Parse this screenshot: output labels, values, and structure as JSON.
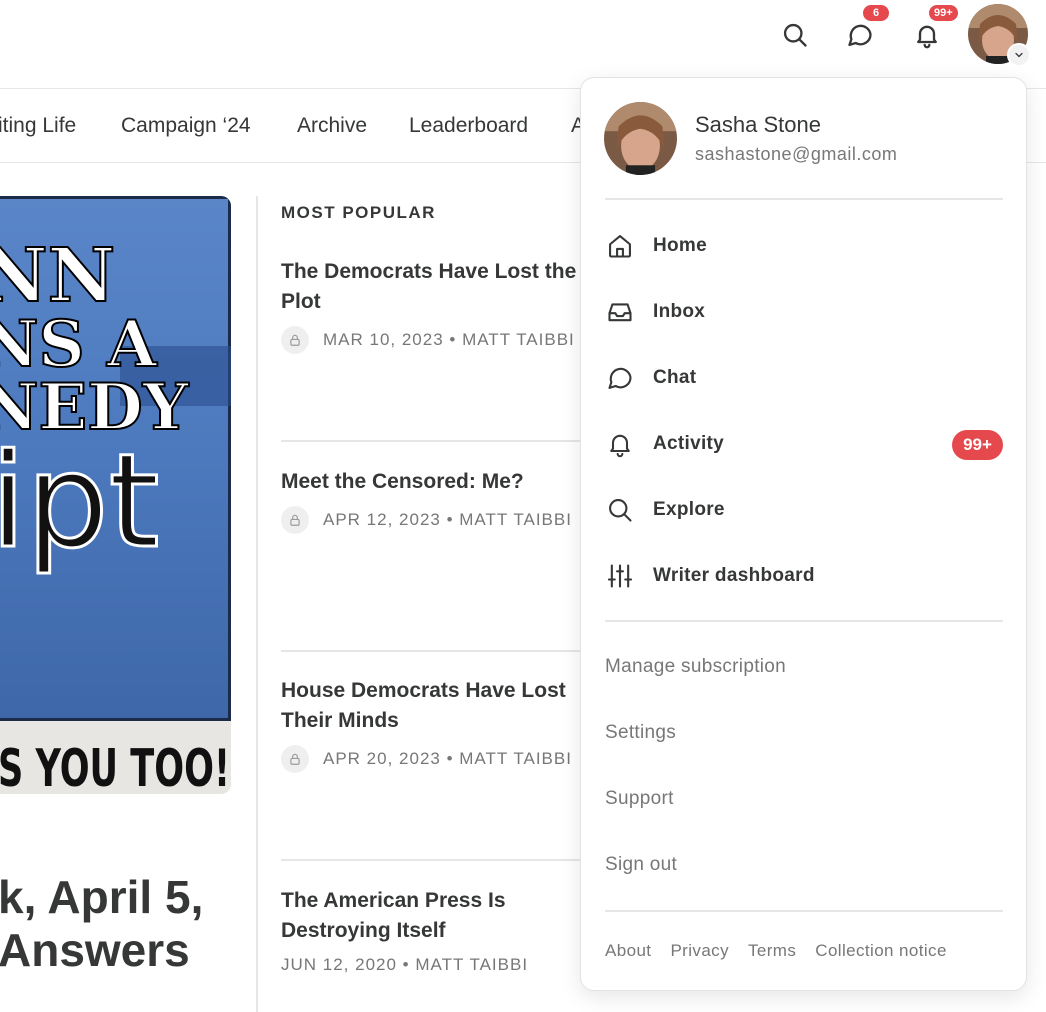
{
  "header": {
    "chat_badge": "6",
    "activity_badge": "99+"
  },
  "nav": {
    "items": [
      "iting Life",
      "Campaign ‘24",
      "Archive",
      "Leaderboard",
      "A"
    ]
  },
  "hero": {
    "image_lines": [
      "NN",
      "NS A",
      "NEDY",
      "ipt",
      "S YOU TOO!"
    ]
  },
  "main_post": {
    "title_line1": "k, April 5,",
    "title_line2": "Answers"
  },
  "most_popular": {
    "heading": "MOST POPULAR",
    "items": [
      {
        "title": "The Democrats Have Lost the Plot",
        "meta": "MAR 10, 2023 • MATT TAIBBI",
        "locked": true
      },
      {
        "title": "Meet the Censored: Me?",
        "meta": "APR 12, 2023 • MATT TAIBBI",
        "locked": true
      },
      {
        "title": "House Democrats Have Lost Their Minds",
        "meta": "APR 20, 2023 • MATT TAIBBI",
        "locked": true
      },
      {
        "title": "The American Press Is Destroying Itself",
        "meta": "JUN 12, 2020 • MATT TAIBBI",
        "locked": false
      }
    ]
  },
  "menu": {
    "user_name": "Sasha Stone",
    "user_email": "sashastone@gmail.com",
    "items": [
      {
        "label": "Home",
        "icon": "home-icon"
      },
      {
        "label": "Inbox",
        "icon": "inbox-icon"
      },
      {
        "label": "Chat",
        "icon": "chat-icon"
      },
      {
        "label": "Activity",
        "icon": "bell-icon",
        "badge": "99+"
      },
      {
        "label": "Explore",
        "icon": "search-icon"
      },
      {
        "label": "Writer dashboard",
        "icon": "sliders-icon"
      }
    ],
    "secondary": [
      "Manage subscription",
      "Settings",
      "Support",
      "Sign out"
    ],
    "footer": [
      "About",
      "Privacy",
      "Terms",
      "Collection notice"
    ]
  },
  "colors": {
    "badge": "#e5484d",
    "text": "#363737",
    "muted": "#777777",
    "divider": "#e6e6e6"
  }
}
